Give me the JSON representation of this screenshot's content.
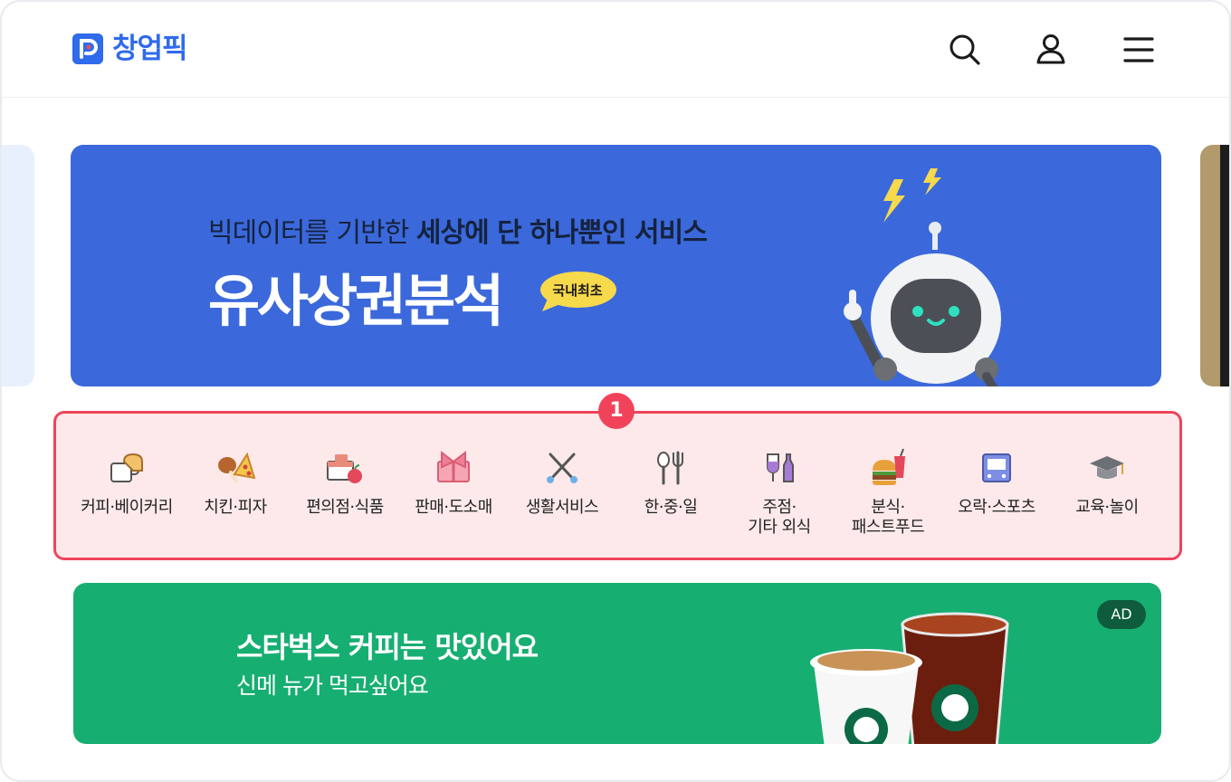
{
  "header": {
    "logo_text": "창업픽",
    "icons": [
      "search-icon",
      "user-icon",
      "menu-icon"
    ]
  },
  "hero": {
    "subtitle_plain": "빅데이터를 기반한 ",
    "subtitle_bold": "세상에 단 하나뿐인 서비스",
    "title": "유사상권분석",
    "badge": "국내최초"
  },
  "marker": "1",
  "categories": [
    {
      "label": "커피·베이커리",
      "icon": "coffee-bakery-icon"
    },
    {
      "label": "치킨·피자",
      "icon": "chicken-pizza-icon"
    },
    {
      "label": "편의점·식품",
      "icon": "convenience-store-icon"
    },
    {
      "label": "판매·도소매",
      "icon": "gift-ribbon-icon"
    },
    {
      "label": "생활서비스",
      "icon": "tools-icon"
    },
    {
      "label": "한·중·일",
      "icon": "spoon-fork-icon"
    },
    {
      "label": "주점·\n기타 외식",
      "icon": "bottle-glass-icon"
    },
    {
      "label": "분식·\n패스트푸드",
      "icon": "burger-drink-icon"
    },
    {
      "label": "오락·스포츠",
      "icon": "game-console-icon"
    },
    {
      "label": "교육·놀이",
      "icon": "graduation-cap-icon"
    }
  ],
  "ad": {
    "title": "스타벅스 커피는 맛있어요",
    "subtitle": "신메 뉴가 먹고싶어요",
    "badge": "AD"
  },
  "colors": {
    "brand": "#2f6bea",
    "hero_bg": "#3b69db",
    "highlight_border": "#f0435a",
    "highlight_bg": "#fde9ea",
    "ad_bg": "#17ae72"
  }
}
